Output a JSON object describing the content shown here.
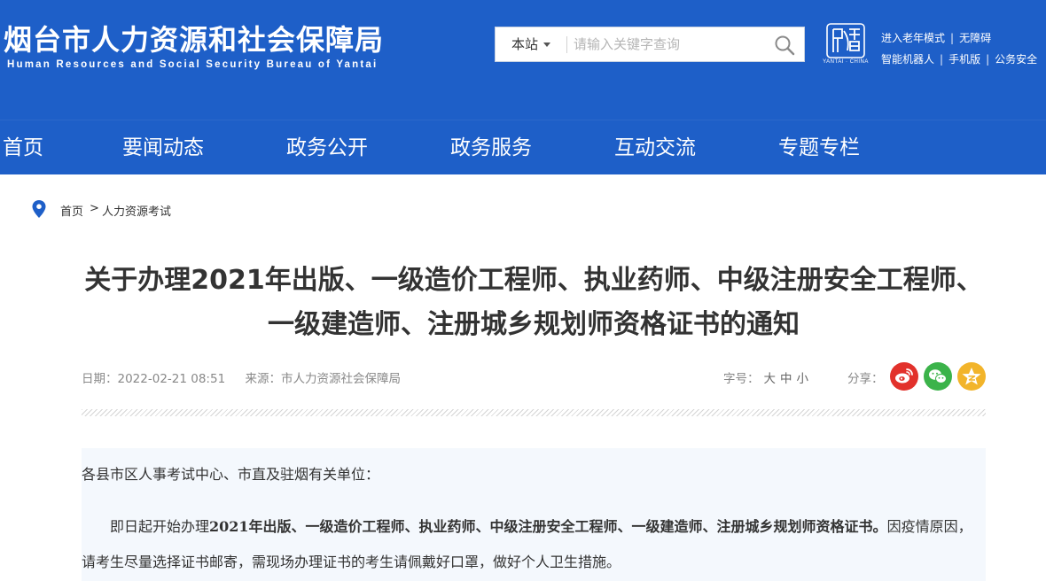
{
  "site": {
    "title": "烟台市人力资源和社会保障局",
    "subtitle": "Human Resources and Social Security Bureau of Yantai",
    "logo_caption": "YANTAI · CHINA"
  },
  "search": {
    "scope": "本站",
    "placeholder": "请输入关键字查询"
  },
  "top_links": {
    "row1": [
      "进入老年模式",
      "无障碍"
    ],
    "row2": [
      "智能机器人",
      "手机版",
      "公务安全"
    ]
  },
  "nav": [
    "首页",
    "要闻动态",
    "政务公开",
    "政务服务",
    "互动交流",
    "专题专栏"
  ],
  "breadcrumb": {
    "home": "首页",
    "sep": ">",
    "current": "人力资源考试"
  },
  "article": {
    "title": "关于办理2021年出版、一级造价工程师、执业药师、中级注册安全工程师、一级建造师、注册城乡规划师资格证书的通知",
    "date_label": "日期：",
    "date": "2022-02-21 08:51",
    "source_label": "来源：",
    "source": "市人力资源社会保障局",
    "fontsize_label": "字号：",
    "fontsize_options": [
      "大",
      "中",
      "小"
    ],
    "share_label": "分享：",
    "share_icons": [
      "weibo-icon",
      "wechat-icon",
      "qzone-icon"
    ],
    "greeting": "各县市区人事考试中心、市直及驻烟有关单位：",
    "para_intro": "即日起开始办理",
    "para_bold": "2021年出版、一级造价工程师、执业药师、中级注册安全工程师、一级建造师、注册城乡规划师资格证书。",
    "para_rest": "因疫情原因，请考生尽量选择证书邮寄，需现场办理证书的考生请佩戴好口罩，做好个人卫生措施。"
  },
  "colors": {
    "brand_blue": "#1e5fc8",
    "weibo": "#e2312b",
    "wechat": "#3bb34a",
    "qzone": "#f2b42a"
  }
}
